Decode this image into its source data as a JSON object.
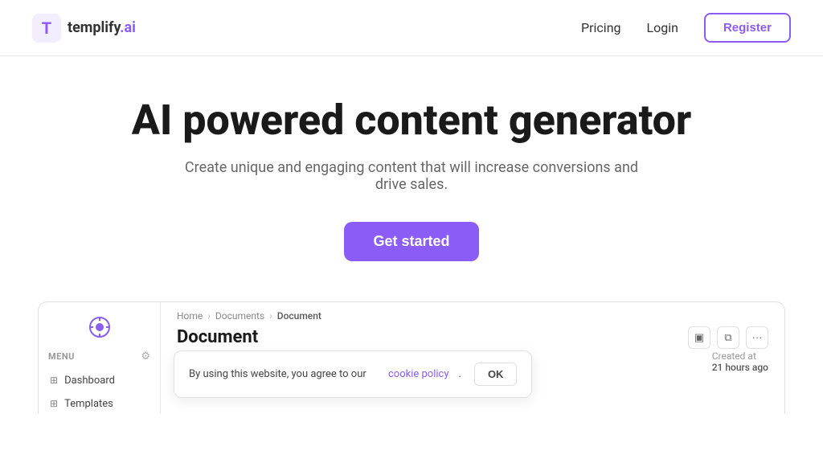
{
  "header": {
    "logo_text_brand": "templify",
    "logo_text_suffix": ".ai",
    "nav": {
      "pricing_label": "Pricing",
      "login_label": "Login",
      "register_label": "Register"
    }
  },
  "hero": {
    "title": "AI powered content generator",
    "subtitle": "Create unique and engaging content that will increase conversions and drive sales.",
    "cta_label": "Get started"
  },
  "app_preview": {
    "sidebar": {
      "menu_label": "MENU",
      "items": [
        {
          "label": "Dashboard"
        },
        {
          "label": "Templates"
        }
      ]
    },
    "breadcrumb": {
      "home": "Home",
      "documents": "Documents",
      "current": "Document"
    },
    "document_title": "Document",
    "doc_actions": [
      "▣",
      "⧉",
      "···"
    ],
    "cookie_banner": {
      "text_before_link": "By using this website, you agree to our",
      "link_text": "cookie policy",
      "text_after_link": ".",
      "ok_label": "OK"
    },
    "created_at": {
      "label": "Created at",
      "time": "21 hours ago"
    }
  }
}
